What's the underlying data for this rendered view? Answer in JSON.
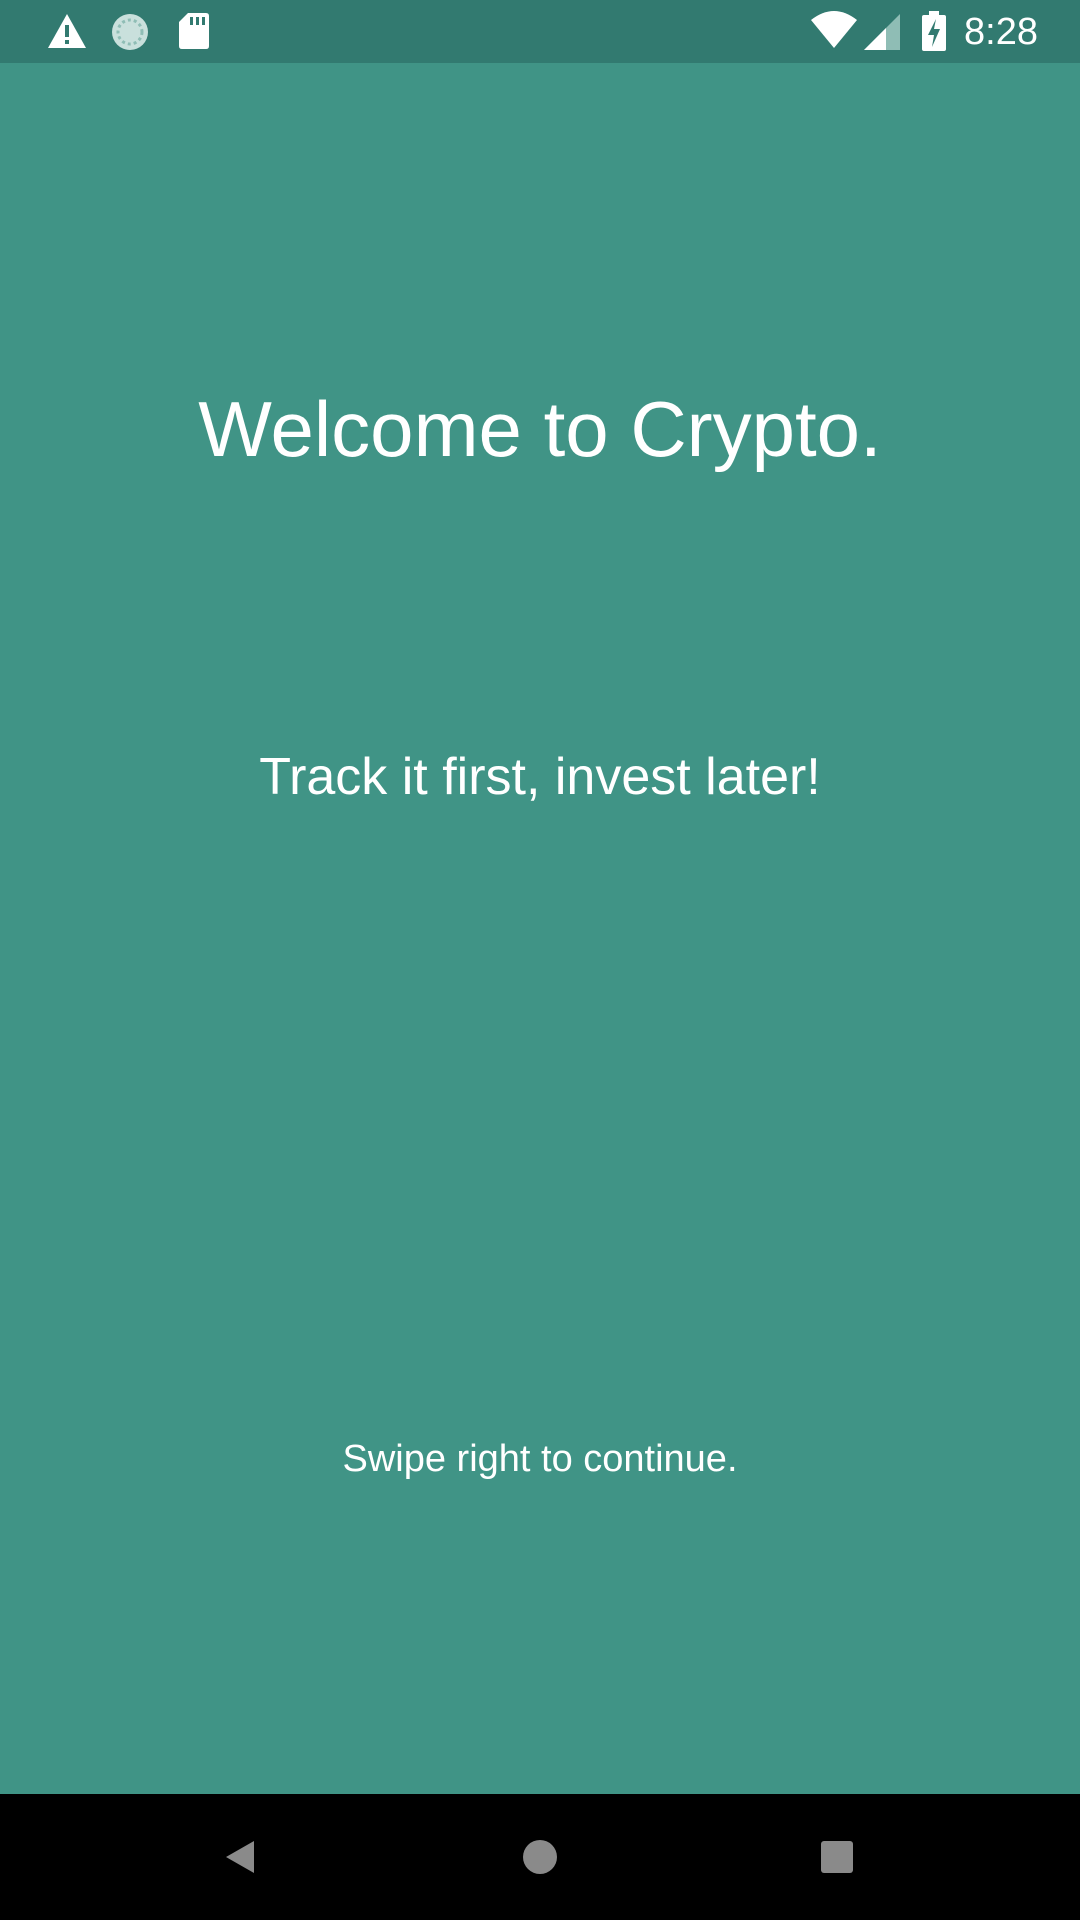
{
  "status_bar": {
    "time": "8:28",
    "icons_left": [
      "warning-icon",
      "sync-icon",
      "sd-card-icon"
    ],
    "icons_right": [
      "wifi-icon",
      "cell-signal-icon",
      "battery-charging-icon"
    ]
  },
  "onboarding": {
    "title": "Welcome to Crypto.",
    "tagline": "Track it first, invest later!",
    "hint": "Swipe right to continue."
  },
  "nav_bar": {
    "buttons": [
      "back-icon",
      "home-icon",
      "recents-icon"
    ]
  },
  "colors": {
    "status_bar_bg": "#327a70",
    "screen_bg": "#409486",
    "text": "#ffffff",
    "nav_bg": "#000000"
  }
}
